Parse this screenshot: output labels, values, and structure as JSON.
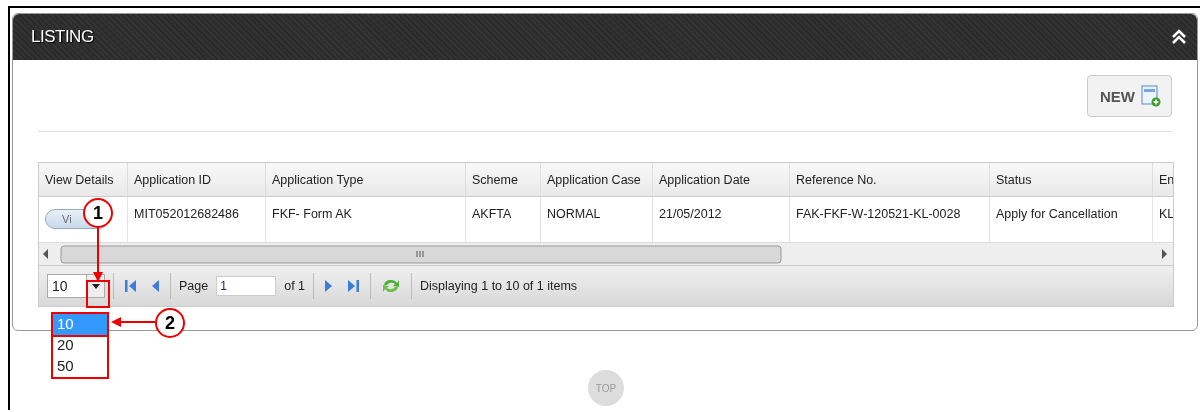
{
  "panel": {
    "title": "LISTING",
    "new_button": "NEW"
  },
  "table": {
    "columns": [
      "View Details",
      "Application ID",
      "Application Type",
      "Scheme",
      "Application Case",
      "Application Date",
      "Reference No.",
      "Status",
      "En"
    ],
    "rows": [
      {
        "cells": [
          "Vi",
          "MIT052012682486",
          "FKF- Form AK",
          "AKFTA",
          "NORMAL",
          "21/05/2012",
          "FAK-FKF-W-120521-KL-0028",
          "Apply for Cancellation",
          "KL"
        ]
      }
    ]
  },
  "pager": {
    "page_size": "10",
    "page_label": "Page",
    "page": "1",
    "of": "of 1",
    "summary": "Displaying 1 to 10 of 1 items",
    "options": [
      {
        "label": "10",
        "selected": true
      },
      {
        "label": "20",
        "selected": false
      },
      {
        "label": "50",
        "selected": false
      }
    ]
  },
  "callouts": [
    "1",
    "2"
  ],
  "top_button": "TOP"
}
